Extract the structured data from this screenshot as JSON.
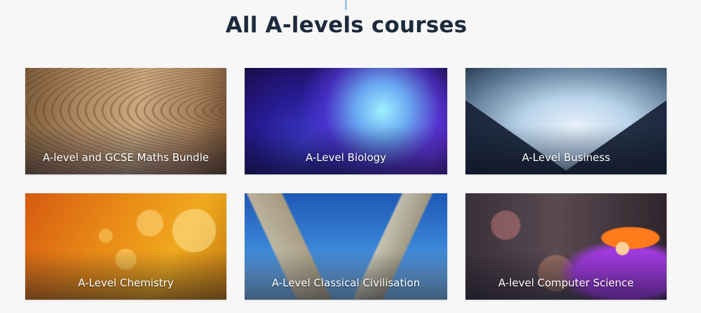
{
  "page": {
    "title": "All A-levels courses"
  },
  "courses": [
    {
      "label": "A-level and GCSE Maths Bundle"
    },
    {
      "label": "A-Level Biology"
    },
    {
      "label": "A-Level Business"
    },
    {
      "label": "A-Level Chemistry"
    },
    {
      "label": "A-Level Classical Civilisation"
    },
    {
      "label": "A-level Computer Science"
    }
  ],
  "colors": {
    "title": "#1d2a3c",
    "accent_line": "#9ec9e6",
    "background": "#f7f7f7",
    "card_label": "#ffffff"
  }
}
